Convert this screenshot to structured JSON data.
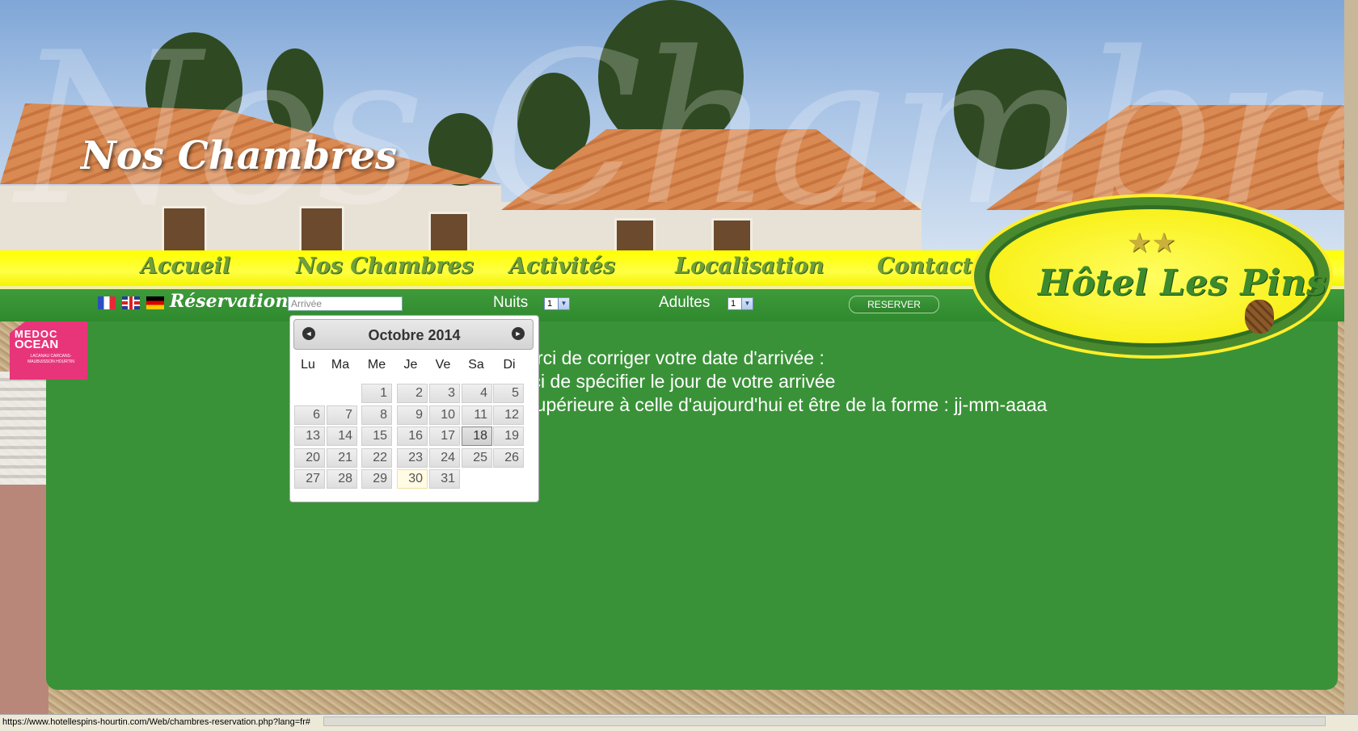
{
  "header": {
    "title": "Nos Chambres",
    "watermark": "Nos Chambres"
  },
  "nav": {
    "items": [
      {
        "label": "Accueil"
      },
      {
        "label": "Nos Chambres"
      },
      {
        "label": "Activités"
      },
      {
        "label": "Localisation"
      },
      {
        "label": "Contact"
      }
    ]
  },
  "logo": {
    "text": "Hôtel Les Pins",
    "stars": "★★"
  },
  "reservation": {
    "label": "Réservation",
    "arrival_placeholder": "Arrivée",
    "nights_label": "Nuits",
    "nights_value": "1",
    "adults_label": "Adultes",
    "adults_value": "1",
    "reserve_button": "RESERVER",
    "select_arrow": "▼"
  },
  "badge": {
    "line1": "MEDOC",
    "line2": "OCEAN",
    "line3": "LACANAU CARCANS-MAUBUISSON HOURTIN"
  },
  "messages": [
    "Merci de corriger votre date d'arrivée :",
    "lerci de spécifier le jour de votre arrivée",
    "e supérieure à celle d'aujourd'hui et être de la forme : jj-mm-aaaa"
  ],
  "datepicker": {
    "title": "Octobre 2014",
    "prev": "◄",
    "next": "►",
    "weekdays": [
      "Lu",
      "Ma",
      "Me",
      "Je",
      "Ve",
      "Sa",
      "Di"
    ],
    "selected_day": "18",
    "today_day": "30",
    "weeks": [
      [
        "",
        "",
        "1",
        "2",
        "3",
        "4",
        "5"
      ],
      [
        "6",
        "7",
        "8",
        "9",
        "10",
        "11",
        "12"
      ],
      [
        "13",
        "14",
        "15",
        "16",
        "17",
        "18",
        "19"
      ],
      [
        "20",
        "21",
        "22",
        "23",
        "24",
        "25",
        "26"
      ],
      [
        "27",
        "28",
        "29",
        "30",
        "31",
        "",
        ""
      ]
    ]
  },
  "status_bar": {
    "url": "https://www.hotellespins-hourtin.com/Web/chambres-reservation.php?lang=fr#"
  },
  "colors": {
    "nav_yellow": "#ffff00",
    "panel_green": "#3a9238",
    "nav_text_green": "#6fa03a",
    "badge_pink": "#e8357a"
  }
}
